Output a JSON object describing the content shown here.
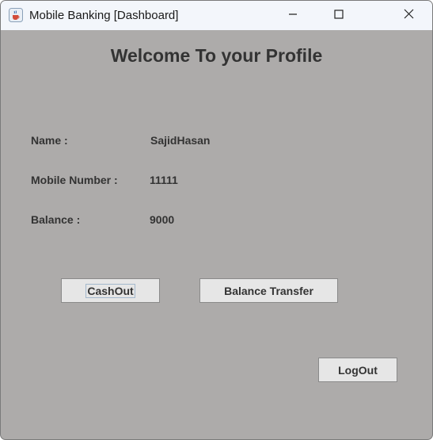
{
  "window": {
    "title": "Mobile Banking [Dashboard]",
    "app_icon": "java-cup-icon",
    "controls": [
      "minimize-icon",
      "maximize-icon",
      "close-icon"
    ]
  },
  "profile": {
    "heading": "Welcome To your Profile",
    "name_label": "Name :",
    "name_value": "SajidHasan",
    "mobile_label": "Mobile Number :",
    "mobile_value": "11111",
    "balance_label": "Balance :",
    "balance_value": "9000"
  },
  "actions": {
    "cashout_label": "CashOut",
    "transfer_label": "Balance Transfer",
    "logout_label": "LogOut"
  },
  "colors": {
    "background": "#adabaa",
    "titlebar": "#f3f6fb",
    "button_face": "#e6e6e6",
    "text": "#333333"
  }
}
